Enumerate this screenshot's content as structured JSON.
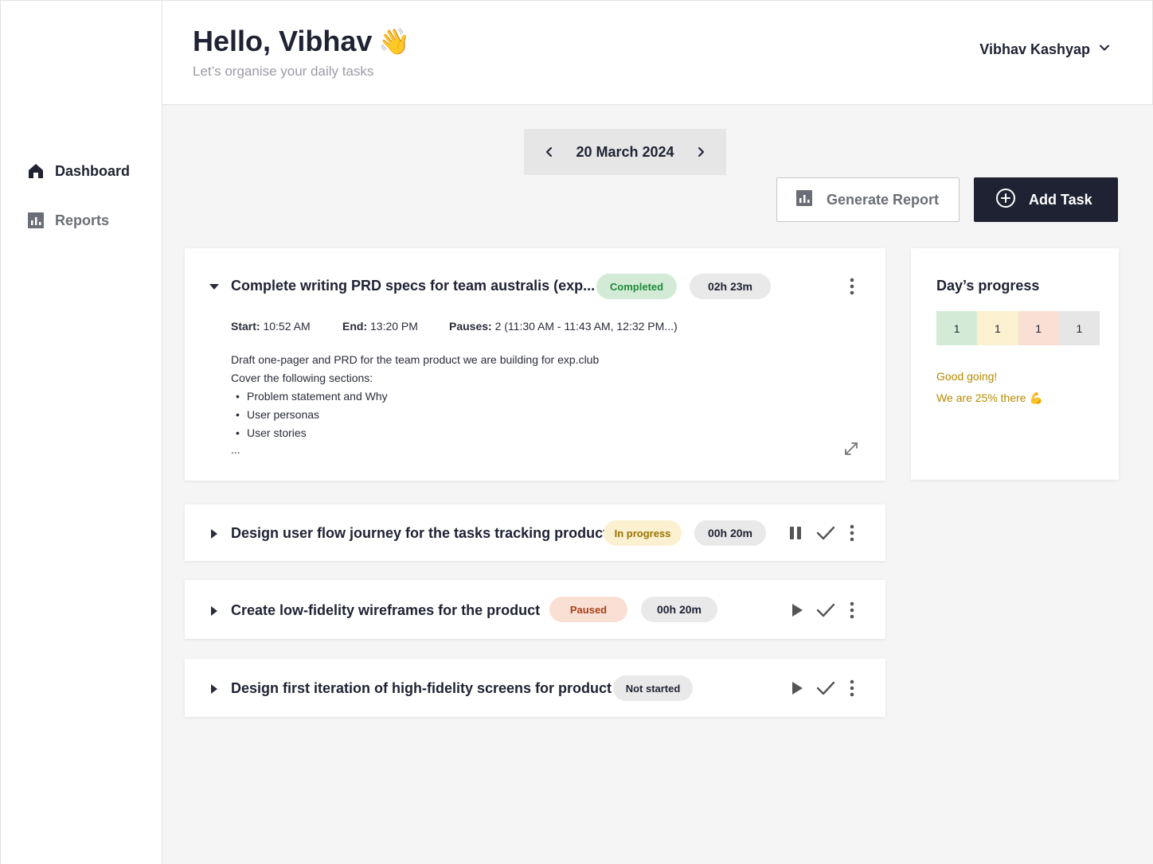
{
  "sidebar": {
    "items": [
      {
        "label": "Dashboard",
        "icon": "home-icon",
        "active": true
      },
      {
        "label": "Reports",
        "icon": "bar-chart-icon",
        "active": false
      }
    ]
  },
  "header": {
    "greeting": "Hello, Vibhav",
    "greeting_emoji": "👋",
    "subtitle": "Let’s organise your daily tasks",
    "user_name": "Vibhav Kashyap"
  },
  "date_nav": {
    "date": "20 March 2024"
  },
  "actions": {
    "generate_report": "Generate Report",
    "add_task": "Add Task"
  },
  "tasks": [
    {
      "title": "Complete writing PRD specs for team australis (exp...",
      "status": "Completed",
      "duration": "02h 23m",
      "expanded": true,
      "start_label": "Start:",
      "start": "10:52 AM",
      "end_label": "End:",
      "end": "13:20 PM",
      "pauses_label": "Pauses:",
      "pauses": "2 (11:30 AM - 11:43 AM, 12:32 PM...)",
      "description_lines": [
        "Draft one-pager and PRD for the team product we are building for exp.club",
        "Cover the following sections:"
      ],
      "bullets": [
        "Problem statement and Why",
        "User personas",
        "User stories"
      ],
      "ellipsis": "..."
    },
    {
      "title": "Design user flow journey for the tasks tracking product",
      "status": "In progress",
      "duration": "00h 20m",
      "expanded": false
    },
    {
      "title": "Create low-fidelity wireframes for the product",
      "status": "Paused",
      "duration": "00h 20m",
      "expanded": false
    },
    {
      "title": "Design first iteration of high-fidelity screens for product",
      "status": "Not started",
      "expanded": false
    }
  ],
  "progress": {
    "title": "Day’s progress",
    "segments": [
      {
        "value": "1",
        "color": "#d3ebd6"
      },
      {
        "value": "1",
        "color": "#fbf0cf"
      },
      {
        "value": "1",
        "color": "#fadfd4"
      },
      {
        "value": "1",
        "color": "#e6e6e6"
      }
    ],
    "message_1": "Good going!",
    "message_2": "We are 25% there 💪"
  },
  "colors": {
    "primary": "#1f2233",
    "completed_bg": "#d3ebd6",
    "completed_text": "#1f8a3a",
    "in_progress_bg": "#fbf0cf",
    "in_progress_text": "#9a7400",
    "paused_bg": "#fadfd4",
    "paused_text": "#a8401a",
    "not_started_bg": "#e9e9e9",
    "accent_text": "#b58a00"
  }
}
